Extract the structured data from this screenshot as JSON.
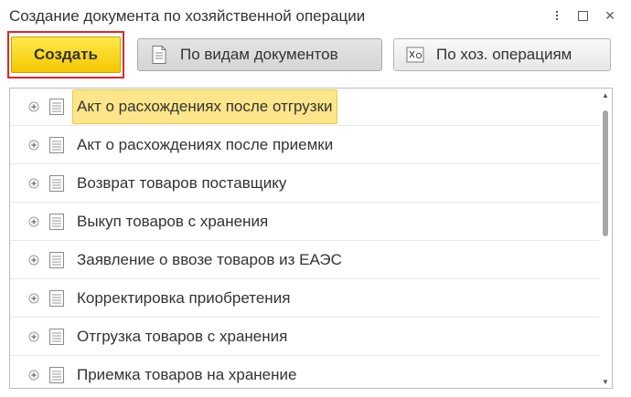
{
  "window": {
    "title": "Создание документа по хозяйственной операции"
  },
  "toolbar": {
    "create_label": "Создать",
    "by_docs_label": "По видам документов",
    "by_ops_label": "По хоз. операциям"
  },
  "list": {
    "items": [
      {
        "label": "Акт о расхождениях после отгрузки",
        "selected": true
      },
      {
        "label": "Акт о расхождениях после приемки",
        "selected": false
      },
      {
        "label": "Возврат товаров поставщику",
        "selected": false
      },
      {
        "label": "Выкуп товаров с хранения",
        "selected": false
      },
      {
        "label": "Заявление о ввозе товаров из ЕАЭС",
        "selected": false
      },
      {
        "label": "Корректировка приобретения",
        "selected": false
      },
      {
        "label": "Отгрузка товаров с хранения",
        "selected": false
      },
      {
        "label": "Приемка товаров на хранение",
        "selected": false
      }
    ]
  },
  "colors": {
    "accent_yellow": "#f5c800",
    "selection": "#fce58a",
    "highlight_frame": "#e0262b"
  }
}
